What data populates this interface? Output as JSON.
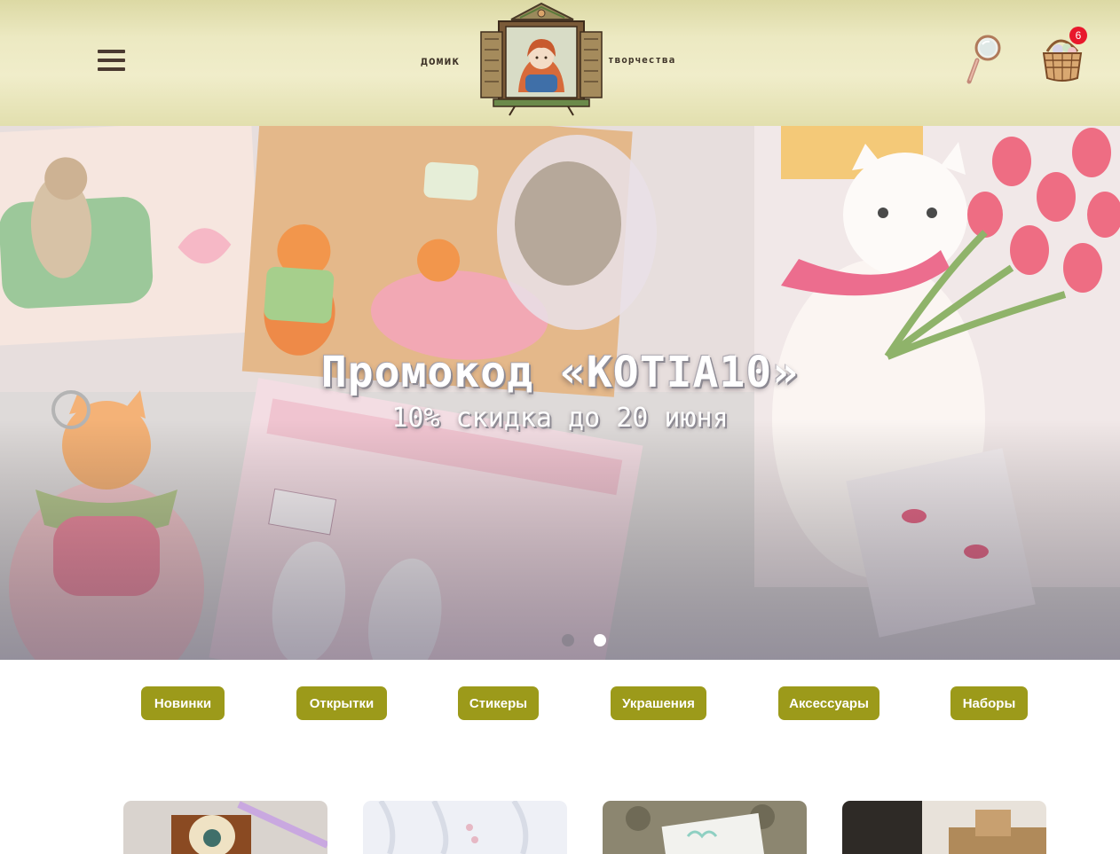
{
  "header": {
    "logo_left": "домик",
    "logo_right": "творчества",
    "menu_icon": "hamburger-menu-icon",
    "search_icon": "magnifier-icon",
    "cart_icon": "basket-icon",
    "cart_count": "6",
    "colors": {
      "header_bg": "#ece9c2",
      "badge": "#e8182c"
    }
  },
  "hero": {
    "title": "Промокод «KOTIA10»",
    "subtitle": "10% скидка до 20 июня",
    "slides_total": 2,
    "active_slide": 2
  },
  "categories": [
    {
      "label": "Новинки"
    },
    {
      "label": "Открытки"
    },
    {
      "label": "Стикеры"
    },
    {
      "label": "Украшения"
    },
    {
      "label": "Аксессуары"
    },
    {
      "label": "Наборы"
    }
  ],
  "accent_color": "#9c9a1a",
  "products_visible": 4
}
